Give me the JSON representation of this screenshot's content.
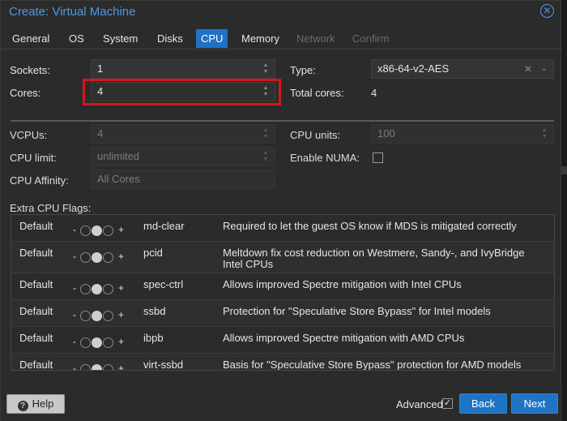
{
  "window": {
    "title": "Create: Virtual Machine"
  },
  "tabs": [
    {
      "label": "General",
      "state": "normal"
    },
    {
      "label": "OS",
      "state": "normal"
    },
    {
      "label": "System",
      "state": "normal"
    },
    {
      "label": "Disks",
      "state": "normal"
    },
    {
      "label": "CPU",
      "state": "active"
    },
    {
      "label": "Memory",
      "state": "normal"
    },
    {
      "label": "Network",
      "state": "disabled"
    },
    {
      "label": "Confirm",
      "state": "disabled"
    }
  ],
  "form": {
    "sockets": {
      "label": "Sockets:",
      "value": "1"
    },
    "cores": {
      "label": "Cores:",
      "value": "4"
    },
    "type": {
      "label": "Type:",
      "value": "x86-64-v2-AES",
      "clear_icon": "close-icon",
      "dropdown_icon": "chevron-down-icon"
    },
    "total_cores": {
      "label": "Total cores:",
      "value": "4"
    },
    "vcpus": {
      "label": "VCPUs:",
      "value": "4"
    },
    "cpu_units": {
      "label": "CPU units:",
      "value": "100"
    },
    "cpu_limit": {
      "label": "CPU limit:",
      "value": "unlimited"
    },
    "enable_numa": {
      "label": "Enable NUMA:",
      "checked": false
    },
    "cpu_affinity": {
      "label": "CPU Affinity:",
      "placeholder": "All Cores"
    },
    "extra_flags_label": "Extra CPU Flags:"
  },
  "flags": [
    {
      "state": "Default",
      "name": "md-clear",
      "desc": "Required to let the guest OS know if MDS is mitigated correctly"
    },
    {
      "state": "Default",
      "name": "pcid",
      "desc": "Meltdown fix cost reduction on Westmere, Sandy-, and IvyBridge Intel CPUs"
    },
    {
      "state": "Default",
      "name": "spec-ctrl",
      "desc": "Allows improved Spectre mitigation with Intel CPUs"
    },
    {
      "state": "Default",
      "name": "ssbd",
      "desc": "Protection for \"Speculative Store Bypass\" for Intel models"
    },
    {
      "state": "Default",
      "name": "ibpb",
      "desc": "Allows improved Spectre mitigation with AMD CPUs"
    },
    {
      "state": "Default",
      "name": "virt-ssbd",
      "desc": "Basis for \"Speculative Store Bypass\" protection for AMD models"
    }
  ],
  "flag_toggle": {
    "minus": "-",
    "plus": "+"
  },
  "footer": {
    "help_label": "Help",
    "advanced_label": "Advanced",
    "advanced_checked": true,
    "back_label": "Back",
    "next_label": "Next"
  },
  "colors": {
    "accent": "#1f73c4",
    "title": "#4a9be5",
    "highlight": "#d3171b"
  }
}
